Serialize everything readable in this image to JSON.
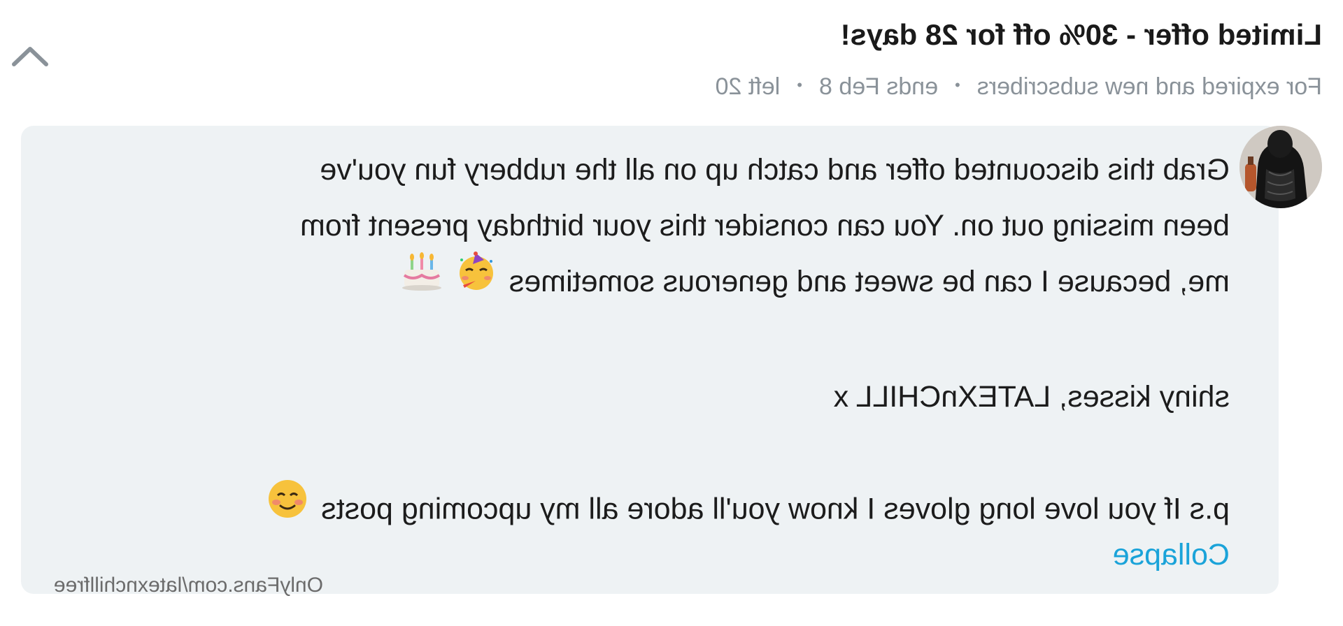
{
  "offer": {
    "title": "Limited offer - 30% off for 28 days!",
    "audience": "For expired and new subscribers",
    "ends": "ends Feb 8",
    "remaining": "left 20",
    "separator": "•"
  },
  "message": {
    "lines": [
      "Grab this discounted offer and catch up on all the rubbery fun you've",
      "been missing out on. You can consider this your birthday present from",
      "me, because I can be sweet and generous sometimes"
    ],
    "signature": "shiny kisses, LATEXnCHILL x",
    "postscript": "p.s If you love long gloves I know you'll adore all my upcoming posts",
    "collapse_label": "Collapse"
  },
  "icons": {
    "chevron": "chevron-up-icon",
    "party_face": "partying-face-emoji",
    "cake": "birthday-cake-emoji",
    "smile": "smiling-face-emoji"
  },
  "colors": {
    "bubble_bg": "#eef2f4",
    "link": "#1aa3d9",
    "meta_text": "#8a9299"
  },
  "watermark": "OnlyFans.com/latexnchillfree",
  "mirrored": true
}
